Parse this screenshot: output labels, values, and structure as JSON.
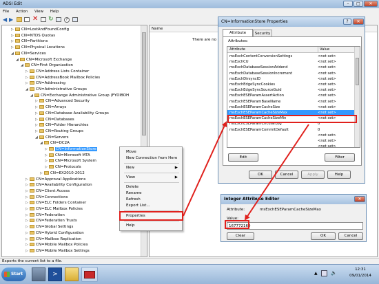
{
  "adsi": {
    "title": "ADSI Edit",
    "menu": [
      "File",
      "Action",
      "View",
      "Help"
    ],
    "list_header_name": "Name",
    "list_empty": "There are no ite",
    "tree": [
      "CN=LostAndFoundConfig",
      "CN=NTDS Quotas",
      "CN=Partitions",
      "CN=Physical Locations",
      "CN=Services",
      "CN=Microsoft Exchange",
      "CN=First Organization",
      "CN=Address Lists Container",
      "CN=AddressBook Mailbox Policies",
      "CN=Addressing",
      "CN=Administrative Groups",
      "CN=Exchange Administrative Group (FYDIBOH",
      "CN=Advanced Security",
      "CN=Arrays",
      "CN=Database Availability Groups",
      "CN=Databases",
      "CN=Folder Hierarchies",
      "CN=Routing Groups",
      "CN=Servers",
      "CN=DC2A",
      "CN=InformationStore",
      "CN=Microsoft MTA",
      "CN=Microsoft System",
      "CN=Protocols",
      "CN=EX2010-2012",
      "CN=Approval Applications",
      "CN=Availability Configuration",
      "CN=Client Access",
      "CN=Connections",
      "CN=ELC Folders Container",
      "CN=ELC Mailbox Policies",
      "CN=Federation",
      "CN=Federation Trusts",
      "CN=Global Settings",
      "CN=Hybrid Configuration",
      "CN=Mailbox Replication",
      "CN=Mobile Mailbox Policies",
      "CN=Mobile Mailbox Settings"
    ],
    "status": "Exports the current list to a file."
  },
  "context_menu": {
    "items": [
      "Move",
      "New Connection from Here",
      "New",
      "View",
      "Delete",
      "Rename",
      "Refresh",
      "Export List...",
      "Properties",
      "Help"
    ]
  },
  "props": {
    "title": "CN=InformationStore Properties",
    "tabs": [
      "Attribute Editor",
      "Security"
    ],
    "attributes_label": "Attributes:",
    "col_attribute": "Attribute",
    "col_value": "Value",
    "rows": [
      {
        "a": "msExchContentConversionSettings",
        "v": "<not set>"
      },
      {
        "a": "msExchCU",
        "v": "<not set>"
      },
      {
        "a": "msExchDatabaseSessionAddend",
        "v": "<not set>"
      },
      {
        "a": "msExchDatabaseSessionIncrement",
        "v": "<not set>"
      },
      {
        "a": "msExchDirsyncID",
        "v": "<not set>"
      },
      {
        "a": "msExchEdgeSyncCookies",
        "v": "<not set>"
      },
      {
        "a": "msExchEdgeSyncSourceGuid",
        "v": "<not set>"
      },
      {
        "a": "msExchESEParamAssertAction",
        "v": "<not set>"
      },
      {
        "a": "msExchESEParamBaseName",
        "v": "<not set>"
      },
      {
        "a": "msExchESEParamCacheSize",
        "v": "<not set>"
      },
      {
        "a": "msExchESEParamCacheSizeMax",
        "v": "<not set>"
      },
      {
        "a": "msExchESEParamCacheSizeMin",
        "v": "<not set>"
      },
      {
        "a": "msExchESEParamCircularLog",
        "v": "0"
      },
      {
        "a": "msExchESEParamCommitDefault",
        "v": "0"
      },
      {
        "a": "",
        "v": "<not set>"
      },
      {
        "a": "",
        "v": "<not set>"
      },
      {
        "a": "",
        "v": "<not set>"
      }
    ],
    "buttons": {
      "edit": "Edit",
      "filter": "Filter",
      "ok": "OK",
      "cancel": "Cancel",
      "apply": "Apply",
      "help": "Help"
    }
  },
  "int_editor": {
    "title": "Integer Attribute Editor",
    "attribute_label": "Attribute:",
    "attribute_value": "msExchESEParamCacheSizeMax",
    "value_label": "Value:",
    "value": "167772160",
    "buttons": {
      "clear": "Clear",
      "ok": "OK",
      "cancel": "Cancel"
    }
  },
  "taskbar": {
    "start": "Start",
    "time": "12:31",
    "date": "09/01/2014"
  },
  "colors": {
    "highlight": "#3399ff",
    "annotation_red": "#e0201c"
  }
}
